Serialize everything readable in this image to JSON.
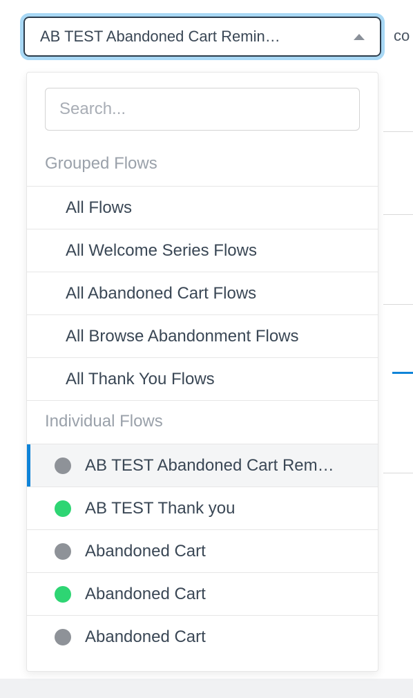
{
  "select": {
    "label": "AB TEST Abandoned Cart Remin…",
    "trailing_text": "co"
  },
  "search": {
    "placeholder": "Search..."
  },
  "sections": {
    "grouped": {
      "header": "Grouped Flows",
      "items": [
        {
          "label": "All Flows"
        },
        {
          "label": "All Welcome Series Flows"
        },
        {
          "label": "All Abandoned Cart Flows"
        },
        {
          "label": "All Browse Abandonment Flows"
        },
        {
          "label": "All Thank You Flows"
        }
      ]
    },
    "individual": {
      "header": "Individual Flows",
      "items": [
        {
          "label": "AB TEST Abandoned Cart Rem…",
          "status": "gray",
          "selected": true
        },
        {
          "label": "AB TEST Thank you",
          "status": "green",
          "selected": false
        },
        {
          "label": "Abandoned Cart",
          "status": "gray",
          "selected": false
        },
        {
          "label": "Abandoned Cart",
          "status": "green",
          "selected": false
        },
        {
          "label": "Abandoned Cart",
          "status": "gray",
          "selected": false
        }
      ]
    }
  },
  "colors": {
    "accent": "#0f84d8",
    "status_gray": "#8e9298",
    "status_green": "#2ed573"
  }
}
